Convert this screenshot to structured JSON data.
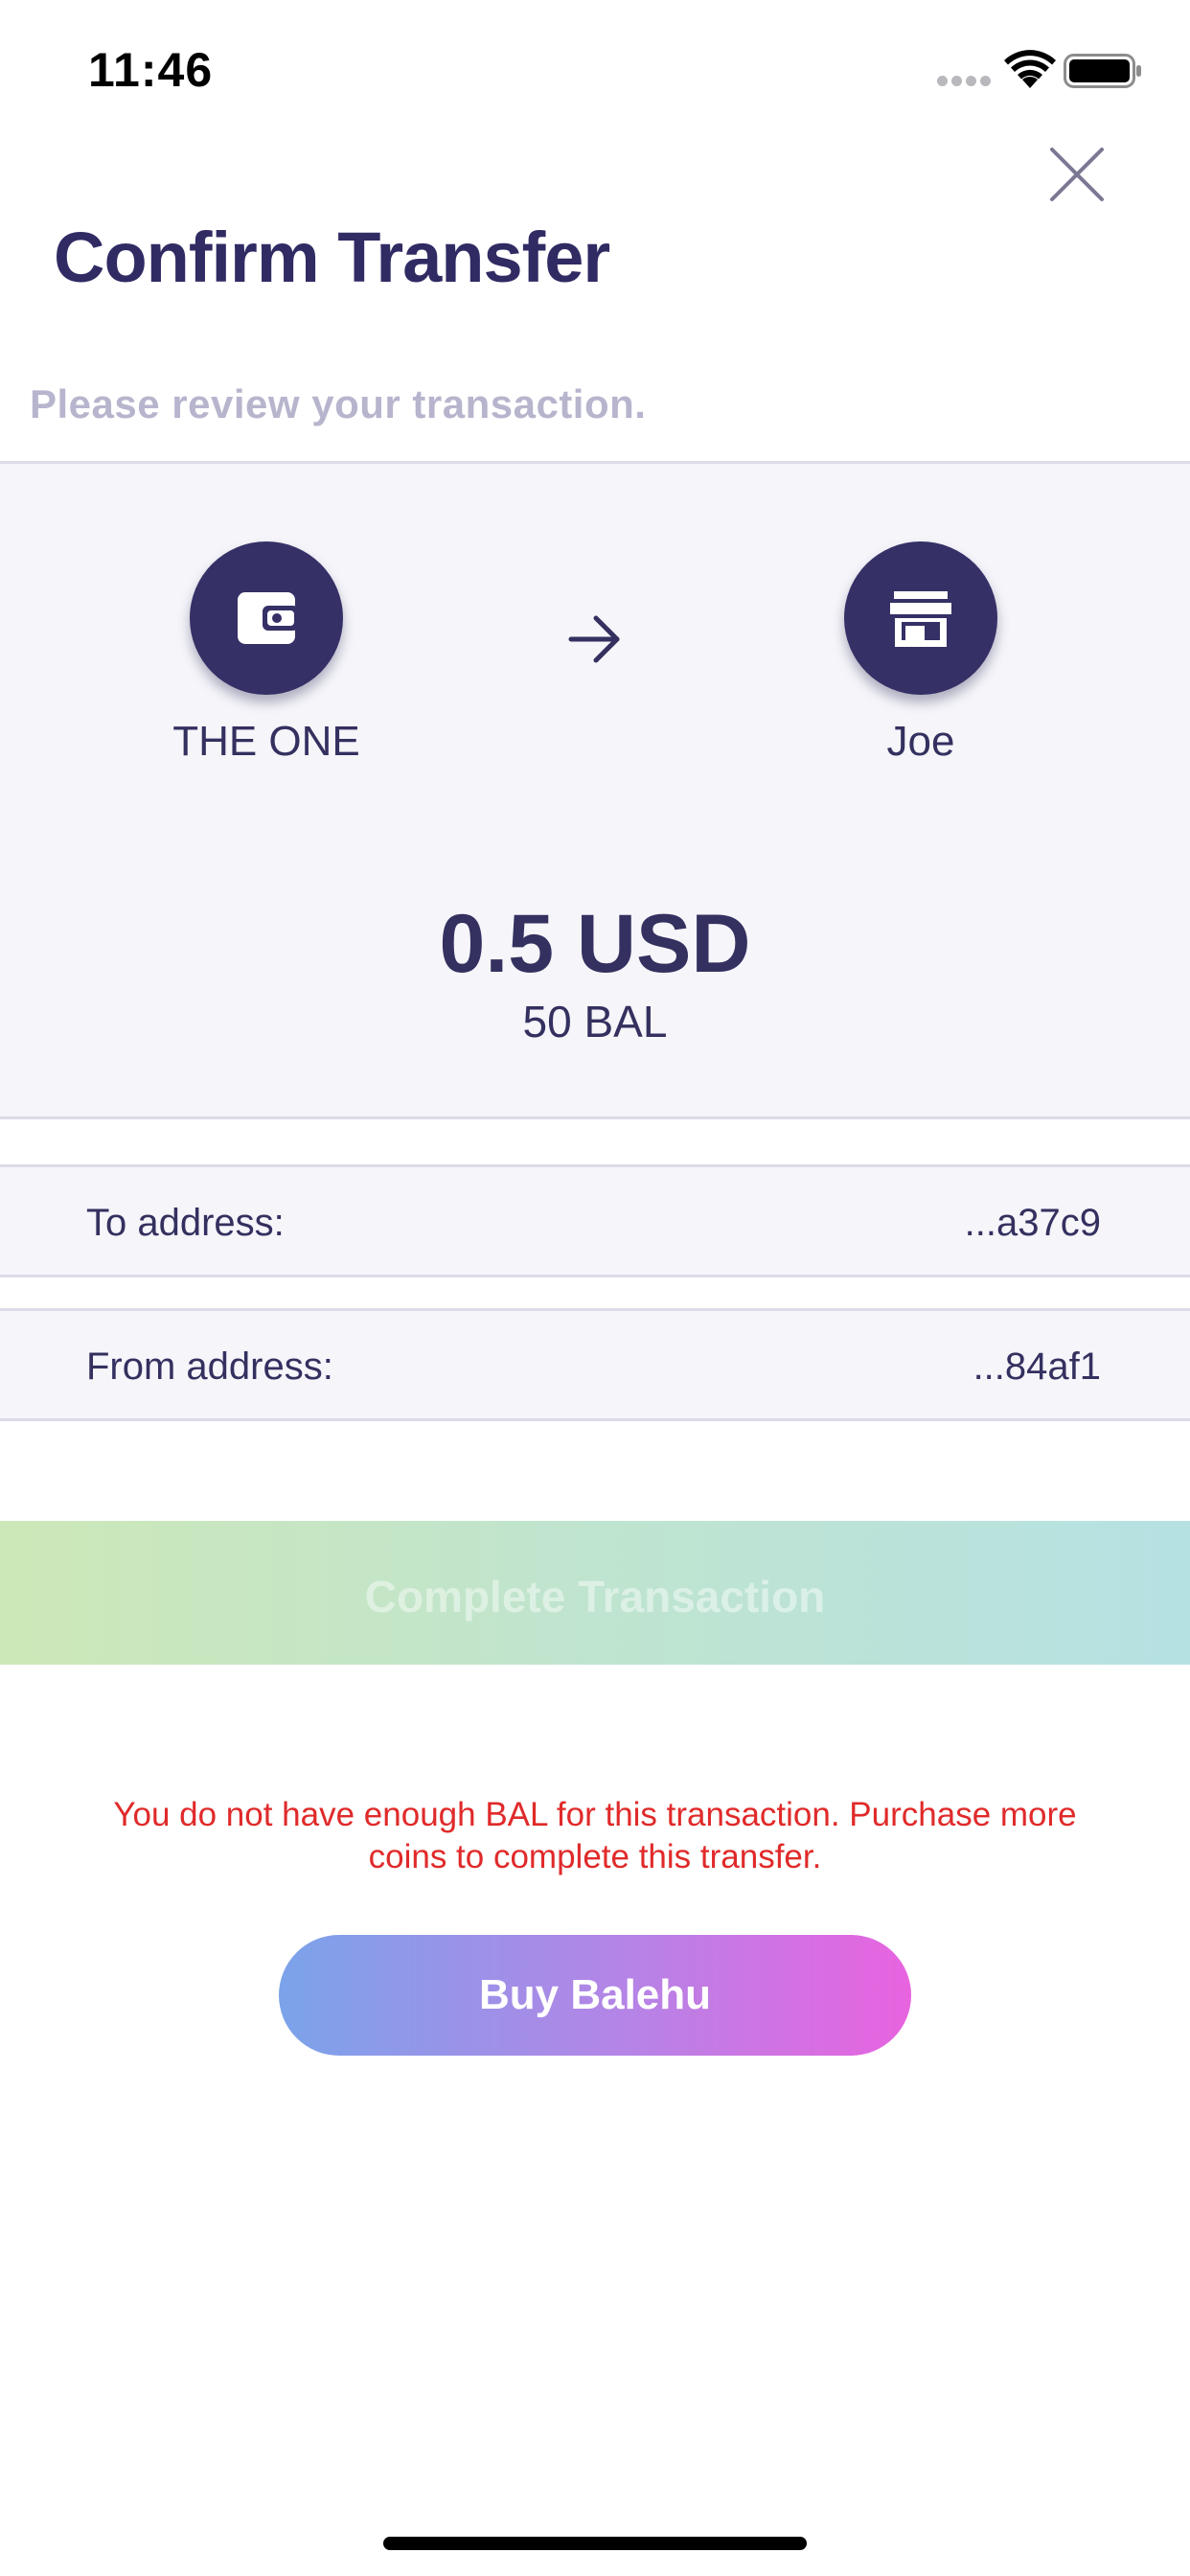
{
  "status_bar": {
    "time": "11:46"
  },
  "header": {
    "title": "Confirm Transfer",
    "subtitle": "Please review your transaction."
  },
  "transfer": {
    "from": {
      "name": "THE ONE",
      "icon": "wallet-icon"
    },
    "to": {
      "name": "Joe",
      "icon": "store-icon"
    },
    "arrow_icon": "arrow-right-icon",
    "amount": "0.5 USD",
    "amount_sub": "50 BAL"
  },
  "addresses": {
    "to_label": "To address:",
    "to_value": "...a37c9",
    "from_label": "From address:",
    "from_value": "...84af1"
  },
  "actions": {
    "complete_label": "Complete Transaction",
    "buy_label": "Buy Balehu"
  },
  "error_message": "You do not have enough BAL for this transaction. Purchase more coins to complete this transfer.",
  "colors": {
    "primary": "#34305f",
    "avatar": "#353066",
    "error": "#e02a2a",
    "panel": "#f5f5fa"
  }
}
